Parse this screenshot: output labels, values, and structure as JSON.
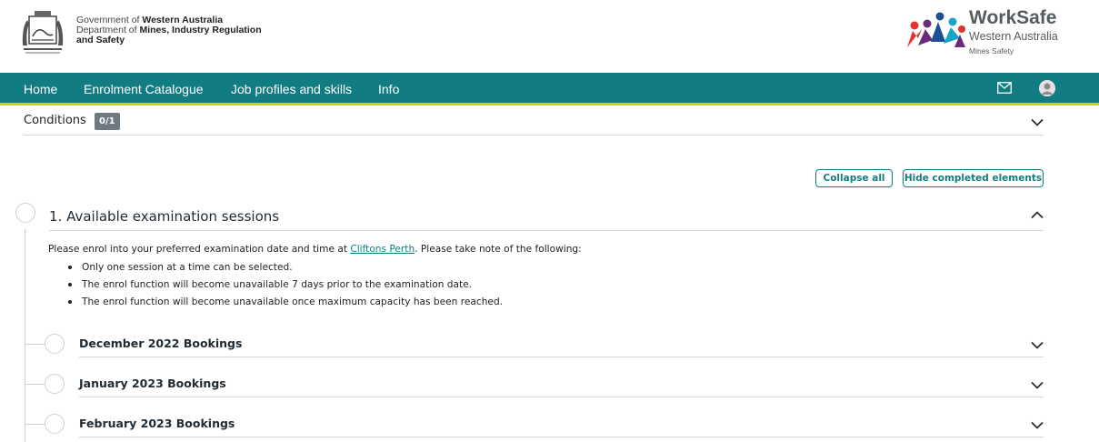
{
  "header": {
    "gov_line1_prefix": "Government of ",
    "gov_line1_bold": "Western Australia",
    "gov_line2_prefix": "Department of ",
    "gov_line2_bold": "Mines, Industry Regulation",
    "gov_line3_bold": "and Safety",
    "brand_name": "WorkSafe",
    "brand_sub": "Western Australia",
    "brand_sub2": "Mines Safety"
  },
  "nav": {
    "items": [
      "Home",
      "Enrolment Catalogue",
      "Job profiles and skills",
      "Info"
    ],
    "mail_icon": "mail-icon",
    "avatar_icon": "user-avatar"
  },
  "conditions": {
    "label": "Conditions",
    "badge": "0/1"
  },
  "buttons": {
    "collapse_all": "Collapse all",
    "hide_completed": "Hide completed elements"
  },
  "section": {
    "title": "1. Available examination sessions",
    "intro_before": "Please enrol into your preferred examination date and time at ",
    "intro_link": "Cliftons Perth",
    "intro_after": ". Please take note of the following:",
    "bullets": [
      "Only one session at a time can be selected.",
      "The enrol function will become unavailable 7 days prior to the examination date.",
      "The enrol function will become unavailable once maximum capacity has been reached."
    ]
  },
  "bookings": [
    "December 2022 Bookings",
    "January 2023 Bookings",
    "February 2023 Bookings"
  ],
  "colors": {
    "nav_bg": "#117d82",
    "nav_underline": "#f2c500",
    "accent": "#117d82",
    "badge_bg": "#6e7a80"
  }
}
